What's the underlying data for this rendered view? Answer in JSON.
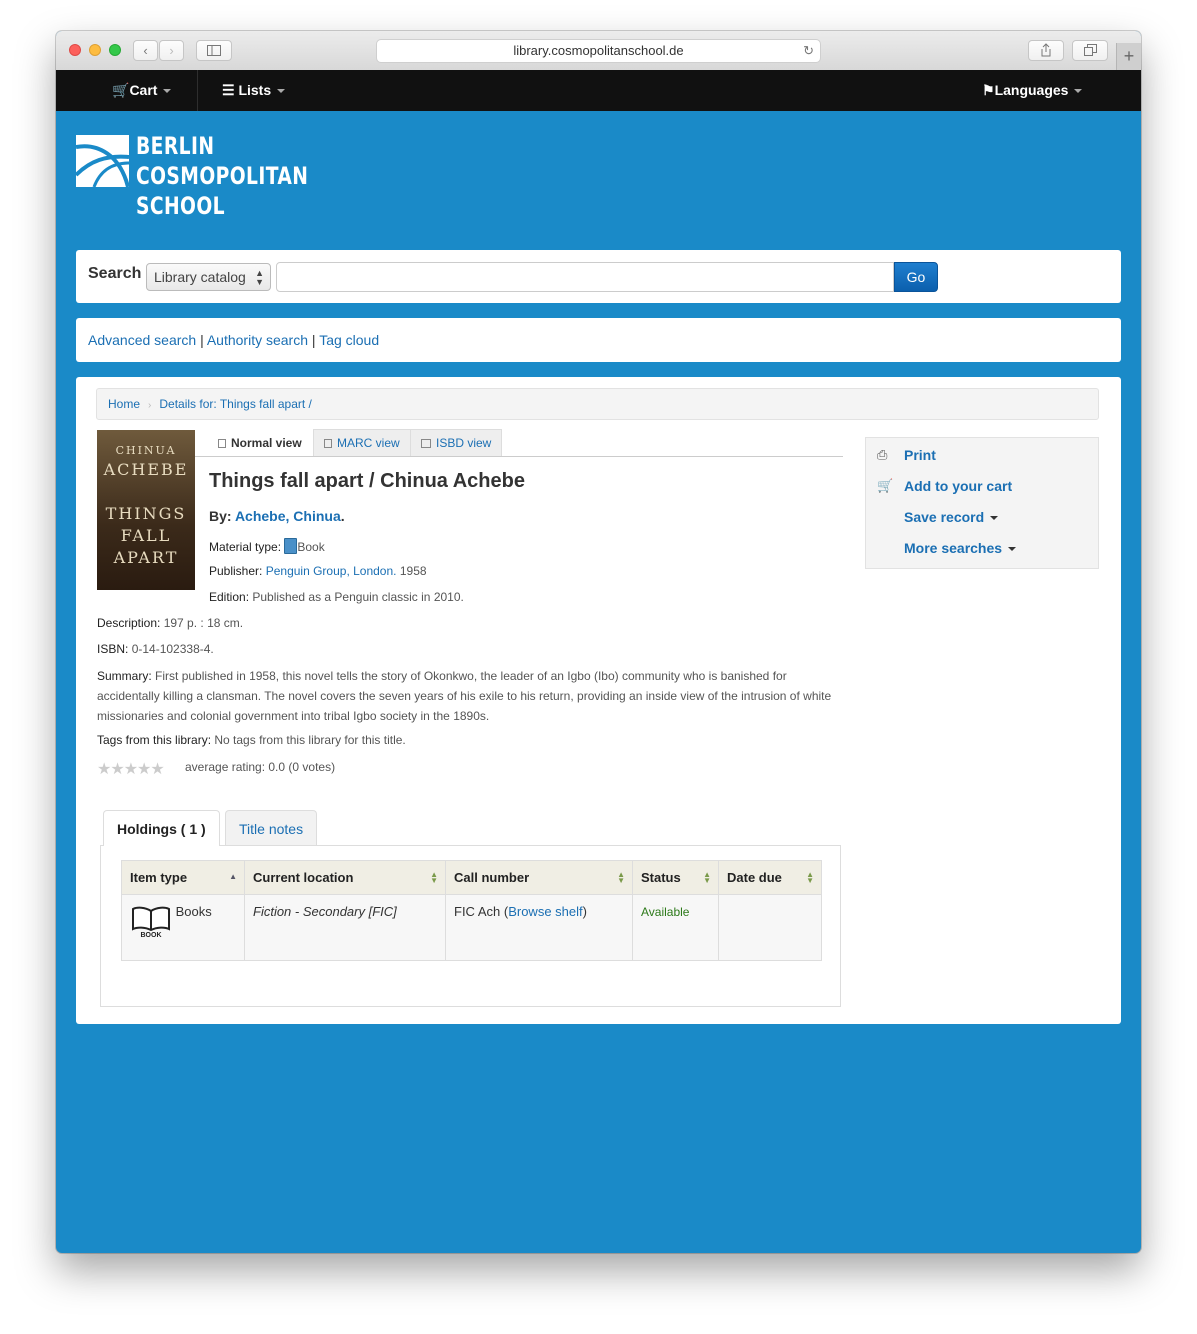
{
  "browser": {
    "url": "library.cosmopolitanschool.de"
  },
  "navbar": {
    "cart": "Cart",
    "lists": "Lists",
    "languages": "Languages"
  },
  "logo": {
    "line1": "BERLIN",
    "line2": "COSMOPOLITAN",
    "line3": "SCHOOL"
  },
  "search": {
    "label": "Search",
    "scope": "Library catalog",
    "placeholder": "",
    "button": "Go"
  },
  "links": {
    "advanced": "Advanced search",
    "authority": "Authority search",
    "tagcloud": "Tag cloud",
    "separator": "|"
  },
  "breadcrumb": {
    "home": "Home",
    "current": "Details for: Things fall apart /"
  },
  "cover": {
    "author_line1": "CHINUA",
    "author_line2": "ACHEBE",
    "title_line1": "THINGS",
    "title_line2": "FALL",
    "title_line3": "APART"
  },
  "view_tabs": {
    "normal": "Normal view",
    "marc": "MARC view",
    "isbd": "ISBD view"
  },
  "record": {
    "title": "Things fall apart / Chinua Achebe",
    "by_label": "By:",
    "author": "Achebe, Chinua",
    "material_label": "Material type:",
    "material": "Book",
    "publisher_label": "Publisher:",
    "publisher": "Penguin Group, London.",
    "year": "1958",
    "edition_label": "Edition:",
    "edition": "Published as a Penguin classic in 2010.",
    "description_label": "Description:",
    "description": "197 p. : 18 cm.",
    "isbn_label": "ISBN:",
    "isbn": "0-14-102338-4.",
    "summary_label": "Summary:",
    "summary": "First published in 1958, this novel tells the story of Okonkwo, the leader of an Igbo (Ibo) community who is banished for accidentally killing a clansman. The novel covers the seven years of his exile to his return, providing an inside view of the intrusion of white missionaries and colonial government into tribal Igbo society in the 1890s.",
    "tags_label": "Tags from this library:",
    "tags": "No tags from this library for this title.",
    "rating_text": "average rating: 0.0 (0 votes)",
    "rating_value": 0
  },
  "sidebar": {
    "print": "Print",
    "add_cart": "Add to your cart",
    "save_record": "Save record",
    "more_searches": "More searches"
  },
  "holdings_tabs": {
    "holdings": "Holdings ( 1 )",
    "notes": "Title notes"
  },
  "holdings_table": {
    "headers": [
      "Item type",
      "Current location",
      "Call number",
      "Status",
      "Date due"
    ],
    "rows": [
      {
        "item_type": "Books",
        "icon_caption": "BOOK",
        "location": "Fiction - Secondary [FIC]",
        "call_number": "FIC Ach",
        "browse_shelf": "Browse shelf",
        "status": "Available",
        "date_due": ""
      }
    ]
  }
}
